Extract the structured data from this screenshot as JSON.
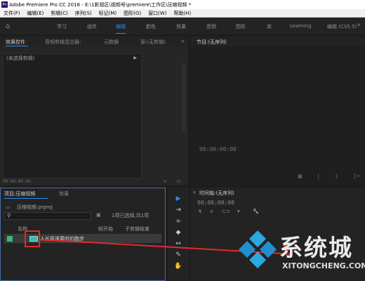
{
  "window": {
    "title": "Adobe Premiere Pro CC 2018 - E:\\1影视区\\视频号\\premiere\\工作区\\压缩视频 *",
    "logo_text": "Pr"
  },
  "menu": [
    "文件(F)",
    "编辑(E)",
    "剪辑(C)",
    "序列(S)",
    "标记(M)",
    "图形(G)",
    "窗口(W)",
    "帮助(H)"
  ],
  "workspaces": {
    "items": [
      "学习",
      "组件",
      "编辑",
      "颜色",
      "效果",
      "音频",
      "图形",
      "库",
      "Learning",
      "编辑 (CS5.5)"
    ],
    "active": "编辑"
  },
  "source_panel": {
    "tabs": [
      "效果控件",
      "音频剪辑混合器:",
      "元数据",
      "源:(无剪辑)"
    ],
    "active_tab": "效果控件",
    "list_item": "(未选择剪辑)",
    "timecode": "00:00:00:00"
  },
  "program_panel": {
    "title": "节目:(无序列)",
    "timecode": "00:00:00:00"
  },
  "project_panel": {
    "tabs": [
      "项目:压缩视频",
      "效果"
    ],
    "active_tab": "项目:压缩视频",
    "file": "压缩视频.prproj",
    "search_placeholder": "",
    "selection_info": "1项已选择,共1项",
    "columns": [
      "名称",
      "帧开始",
      "子剪辑结束"
    ],
    "clip_name": "人长篇谁要听的跑步"
  },
  "timeline_panel": {
    "title": "时间轴:(无序列)",
    "timecode": "00;00;00;00"
  },
  "watermark": {
    "text": "系统城",
    "url": "XITONGCHENG.COM"
  },
  "colors": {
    "accent_blue": "#2d8ceb",
    "annotation_red": "#e42a2a",
    "clip_teal": "#3cb9a8",
    "label_green": "#2fbf71"
  }
}
